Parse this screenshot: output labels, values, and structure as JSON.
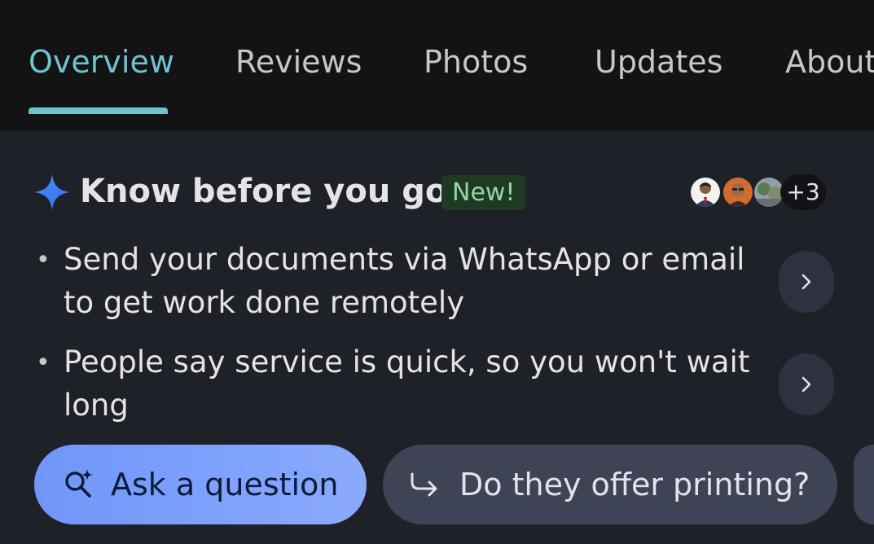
{
  "tabs": [
    {
      "label": "Overview",
      "active": true
    },
    {
      "label": "Reviews",
      "active": false
    },
    {
      "label": "Photos",
      "active": false
    },
    {
      "label": "Updates",
      "active": false
    },
    {
      "label": "About",
      "active": false
    }
  ],
  "summary": {
    "icon": "sparkle-icon",
    "title": "Know before you go",
    "badge": "New!",
    "contributors_more": "+3",
    "items": [
      {
        "text": "Send your documents via WhatsApp or email to get work done remotely"
      },
      {
        "text": "People say service is quick, so you won't wait long"
      }
    ]
  },
  "actions": {
    "ask_label": "Ask a question",
    "suggestion_label": "Do they offer printing?"
  },
  "colors": {
    "accent": "#6ec3d0",
    "background": "#1f2128",
    "tabbar": "#131314",
    "badge_bg": "#1e3a22",
    "badge_text": "#93d8a3",
    "ask_button": "#7b9efb",
    "chip": "#3f4356"
  }
}
